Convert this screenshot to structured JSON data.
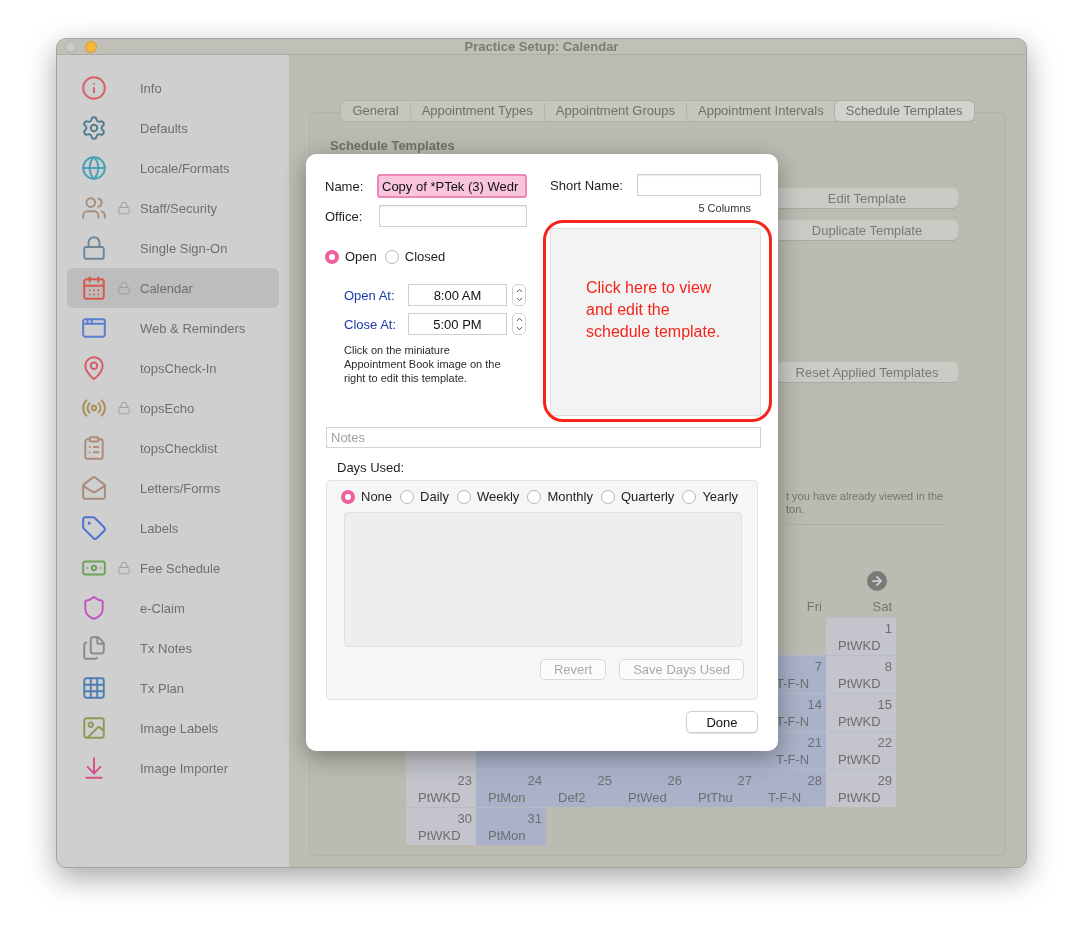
{
  "window": {
    "title": "Practice Setup: Calendar"
  },
  "sidebar": {
    "items": [
      {
        "label": "Info",
        "locked": false,
        "selected": false
      },
      {
        "label": "Defaults",
        "locked": false,
        "selected": false
      },
      {
        "label": "Locale/Formats",
        "locked": false,
        "selected": false
      },
      {
        "label": "Staff/Security",
        "locked": true,
        "selected": false
      },
      {
        "label": "Single Sign-On",
        "locked": false,
        "selected": false
      },
      {
        "label": "Calendar",
        "locked": true,
        "selected": true
      },
      {
        "label": "Web & Reminders",
        "locked": false,
        "selected": false
      },
      {
        "label": "topsCheck-In",
        "locked": false,
        "selected": false
      },
      {
        "label": "topsEcho",
        "locked": true,
        "selected": false
      },
      {
        "label": "topsChecklist",
        "locked": false,
        "selected": false
      },
      {
        "label": "Letters/Forms",
        "locked": false,
        "selected": false
      },
      {
        "label": "Labels",
        "locked": false,
        "selected": false
      },
      {
        "label": "Fee Schedule",
        "locked": true,
        "selected": false
      },
      {
        "label": "e-Claim",
        "locked": false,
        "selected": false
      },
      {
        "label": "Tx Notes",
        "locked": false,
        "selected": false
      },
      {
        "label": "Tx Plan",
        "locked": false,
        "selected": false
      },
      {
        "label": "Image Labels",
        "locked": false,
        "selected": false
      },
      {
        "label": "Image Importer",
        "locked": false,
        "selected": false
      }
    ]
  },
  "tabs": [
    {
      "label": "General",
      "selected": false
    },
    {
      "label": "Appointment Types",
      "selected": false
    },
    {
      "label": "Appointment Groups",
      "selected": false
    },
    {
      "label": "Appointment Intervals",
      "selected": false
    },
    {
      "label": "Schedule Templates",
      "selected": true
    }
  ],
  "panel": {
    "heading": "Schedule Templates",
    "buttons": [
      "Edit Template",
      "Duplicate Template",
      "Reset Applied Templates"
    ],
    "note_lines": [
      "t you have already viewed in the",
      "ton."
    ],
    "calendar": {
      "headers": [
        "Fri",
        "Sat"
      ],
      "weeks": [
        {
          "kind": "lead",
          "cells": [
            {
              "day": "1",
              "label": "PtWKD"
            }
          ]
        },
        {
          "kind": "covered",
          "cells": [
            {
              "day": "7",
              "label": "T-F-N"
            },
            {
              "day": "8",
              "label": "PtWKD"
            }
          ]
        },
        {
          "kind": "covered",
          "cells": [
            {
              "day": "14",
              "label": "T-F-N"
            },
            {
              "day": "15",
              "label": "PtWKD"
            }
          ]
        },
        {
          "kind": "covered",
          "cells": [
            {
              "day": "21",
              "label": "T-F-N"
            },
            {
              "day": "22",
              "label": "PtWKD"
            }
          ]
        },
        {
          "kind": "full",
          "cells": [
            {
              "day": "23",
              "label": "PtWKD"
            },
            {
              "day": "24",
              "label": "PtMon"
            },
            {
              "day": "25",
              "label": "Def2"
            },
            {
              "day": "26",
              "label": "PtWed"
            },
            {
              "day": "27",
              "label": "PtThu"
            },
            {
              "day": "28",
              "label": "T-F-N"
            },
            {
              "day": "29",
              "label": "PtWKD"
            }
          ]
        },
        {
          "kind": "trail",
          "cells": [
            {
              "day": "30",
              "label": "PtWKD"
            },
            {
              "day": "31",
              "label": "PtMon"
            }
          ]
        }
      ]
    }
  },
  "dialog": {
    "name_label": "Name:",
    "name_value": "Copy of *PTek (3) Wedr",
    "office_label": "Office:",
    "short_name_label": "Short Name:",
    "columns_note": "5 Columns",
    "status": [
      {
        "label": "Open",
        "selected": true
      },
      {
        "label": "Closed",
        "selected": false
      }
    ],
    "open_at": {
      "label": "Open At:",
      "value": "8:00 AM"
    },
    "close_at": {
      "label": "Close At:",
      "value": "5:00 PM"
    },
    "help": "Click on the miniature Appointment Book image on the right to edit this template.",
    "preview_callout": "Click here to view and edit the schedule template.",
    "notes_placeholder": "Notes",
    "days_used_label": "Days Used:",
    "days_used": [
      {
        "label": "None",
        "selected": true
      },
      {
        "label": "Daily",
        "selected": false
      },
      {
        "label": "Weekly",
        "selected": false
      },
      {
        "label": "Monthly",
        "selected": false
      },
      {
        "label": "Quarterly",
        "selected": false
      },
      {
        "label": "Yearly",
        "selected": false
      }
    ],
    "days_buttons": [
      {
        "label": "Revert",
        "disabled": true
      },
      {
        "label": "Save Days Used",
        "disabled": true
      }
    ],
    "done": "Done"
  }
}
